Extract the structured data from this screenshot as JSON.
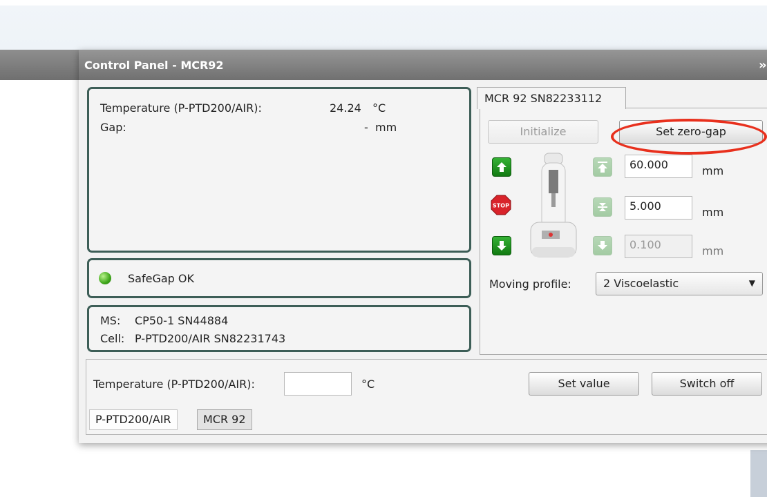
{
  "window": {
    "title": "Control Panel - MCR92",
    "expand_glyph": "»"
  },
  "status_panel": {
    "temperature_label": "Temperature (P-PTD200/AIR):",
    "temperature_value": "24.24",
    "temperature_unit": "°C",
    "gap_label": "Gap:",
    "gap_value": "-",
    "gap_unit": "mm"
  },
  "safegap": {
    "label": "SafeGap OK",
    "status_color": "#3ea61a"
  },
  "info_panel": {
    "ms_label": "MS:",
    "ms_value": "CP50-1 SN44884",
    "cell_label": "Cell:",
    "cell_value": "P-PTD200/AIR SN82231743"
  },
  "device_tab": {
    "label": "MCR 92 SN82233112",
    "initialize_label": "Initialize",
    "set_zero_gap_label": "Set zero-gap",
    "move_up_icon": "arrow-up-icon",
    "stop_icon": "stop-icon",
    "move_down_icon": "arrow-down-icon",
    "positions": [
      {
        "icon": "move-to-top-icon",
        "value": "60.000",
        "unit": "mm",
        "enabled": true
      },
      {
        "icon": "move-to-measuring-gap-icon",
        "value": "5.000",
        "unit": "mm",
        "enabled": true
      },
      {
        "icon": "move-down-step-icon",
        "value": "0.100",
        "unit": "mm",
        "enabled": false
      }
    ],
    "moving_profile_label": "Moving profile:",
    "moving_profile_value": "2 Viscoelastic"
  },
  "bottom": {
    "temperature_label": "Temperature (P-PTD200/AIR):",
    "temperature_input": "",
    "temperature_unit": "°C",
    "set_value_label": "Set value",
    "switch_off_label": "Switch off",
    "tabs": [
      {
        "label": "P-PTD200/AIR",
        "active": true
      },
      {
        "label": "MCR 92",
        "active": false
      }
    ]
  },
  "annotation": {
    "highlight_color": "#e8301d",
    "highlight_target": "Set zero-gap"
  }
}
